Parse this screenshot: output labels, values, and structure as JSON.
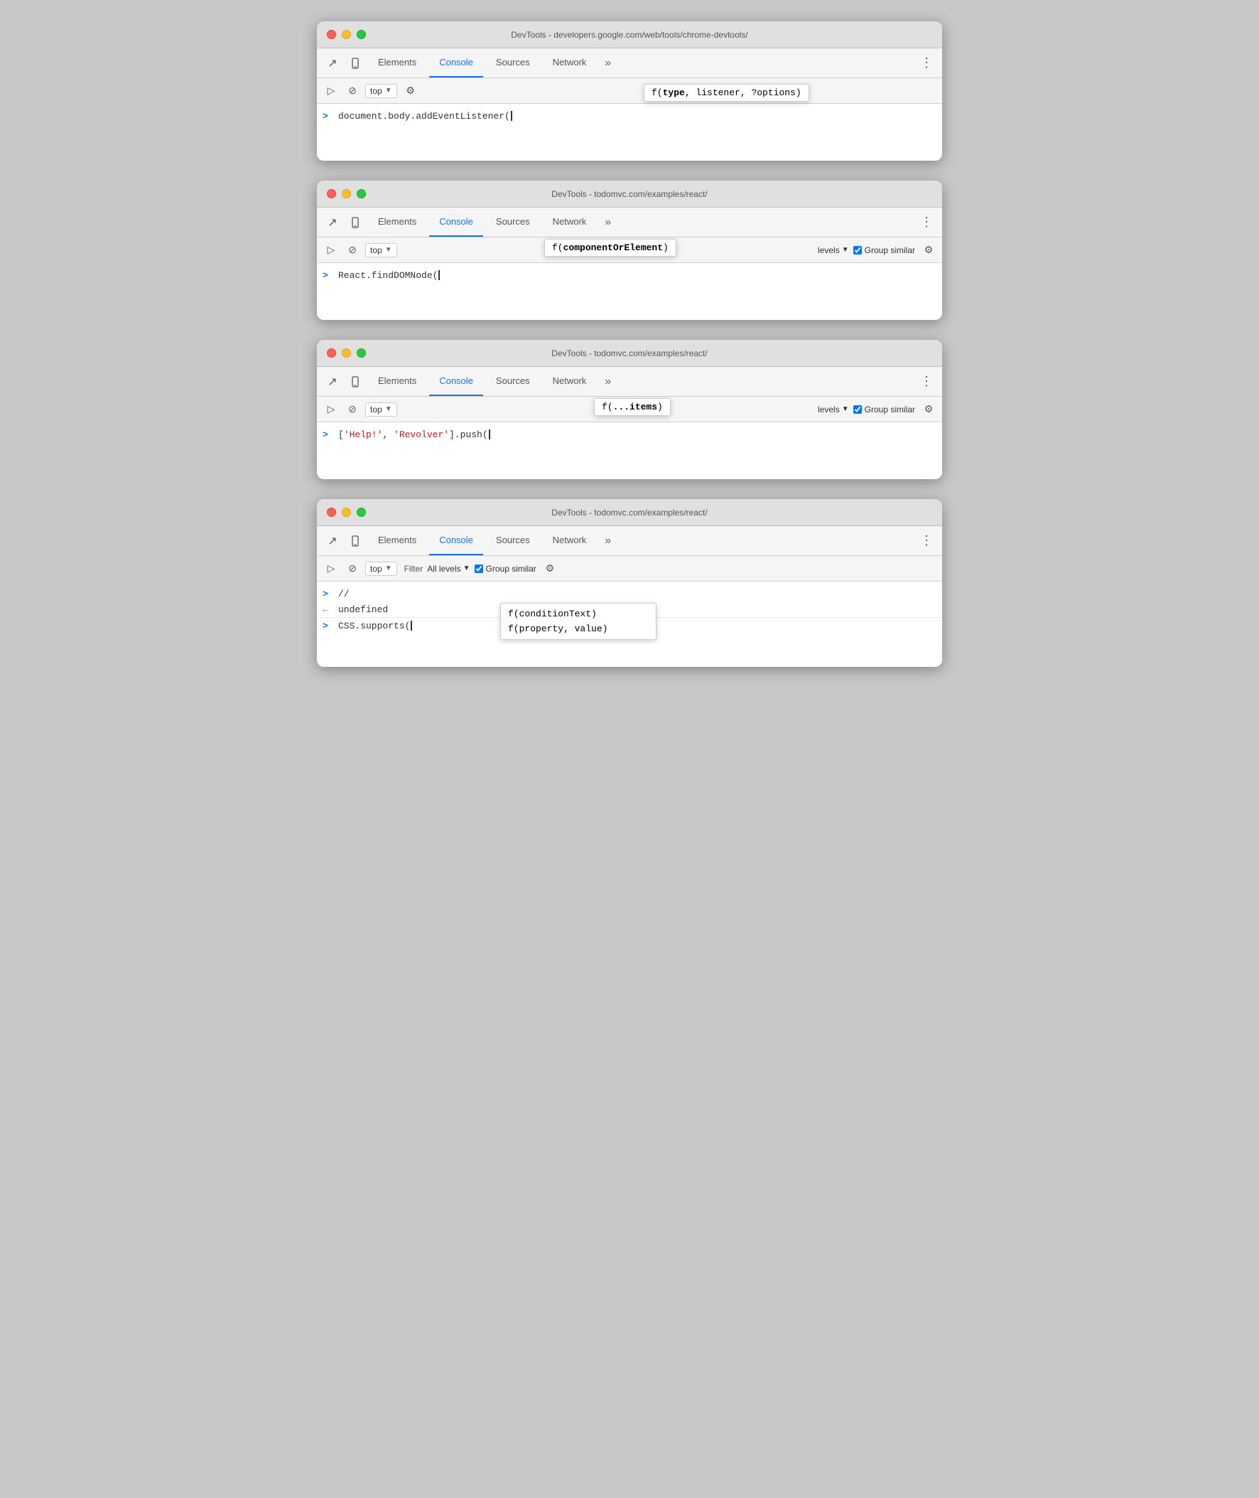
{
  "windows": [
    {
      "id": "window-1",
      "titleBar": {
        "text": "DevTools - developers.google.com/web/tools/chrome-devtools/"
      },
      "tabs": {
        "items": [
          "Elements",
          "Console",
          "Sources",
          "Network"
        ],
        "active": "Console",
        "more": "»"
      },
      "toolbar": {
        "context": "top",
        "showFilter": false,
        "showLevels": false,
        "showGroupSimilar": false
      },
      "autocomplete": {
        "text": "f(",
        "bold": "type",
        "rest": ", listener, ?options)"
      },
      "consoleLine": {
        "prompt": ">",
        "code": "document.body.addEventListener("
      }
    },
    {
      "id": "window-2",
      "titleBar": {
        "text": "DevTools - todomvc.com/examples/react/"
      },
      "tabs": {
        "items": [
          "Elements",
          "Console",
          "Sources",
          "Network"
        ],
        "active": "Console",
        "more": "»"
      },
      "toolbar": {
        "context": "top",
        "showFilter": false,
        "showLevels": true,
        "showGroupSimilar": true
      },
      "autocomplete": {
        "text": "f(",
        "bold": "componentOrElement",
        "rest": ")"
      },
      "consoleLine": {
        "prompt": ">",
        "code": "React.findDOMNode("
      }
    },
    {
      "id": "window-3",
      "titleBar": {
        "text": "DevTools - todomvc.com/examples/react/"
      },
      "tabs": {
        "items": [
          "Elements",
          "Console",
          "Sources",
          "Network"
        ],
        "active": "Console",
        "more": "»"
      },
      "toolbar": {
        "context": "top",
        "showFilter": false,
        "showLevels": true,
        "showGroupSimilar": true
      },
      "autocomplete": {
        "text": "f(",
        "bold": "...items",
        "rest": ")"
      },
      "consoleLine": {
        "prompt": ">",
        "codePrefix": "[",
        "str1": "'Help!'",
        "sep": ", ",
        "str2": "'Revolver'",
        "codeSuffix": "].push("
      }
    },
    {
      "id": "window-4",
      "titleBar": {
        "text": "DevTools - todomvc.com/examples/react/"
      },
      "tabs": {
        "items": [
          "Elements",
          "Console",
          "Sources",
          "Network"
        ],
        "active": "Console",
        "more": "»"
      },
      "toolbar": {
        "context": "top",
        "filter": "Filter",
        "levels": "All levels",
        "showGroupSimilar": true
      },
      "autocompleteMulti": [
        {
          "text": "f(",
          "bold": "conditionText",
          "rest": ")"
        },
        {
          "text": "f(",
          "bold": "property",
          "rest": ", value)"
        }
      ],
      "consoleLines": [
        {
          "prompt": ">",
          "type": "comment",
          "code": "//"
        },
        {
          "prompt": "←",
          "type": "undef",
          "code": "undefined"
        },
        {
          "prompt": ">",
          "type": "normal",
          "code": "CSS.supports("
        }
      ]
    }
  ],
  "labels": {
    "elements": "Elements",
    "console": "Console",
    "sources": "Sources",
    "network": "Network",
    "more": "»",
    "top": "top",
    "filter": "Filter",
    "allLevels": "All levels",
    "groupSimilar": "Group similar"
  }
}
